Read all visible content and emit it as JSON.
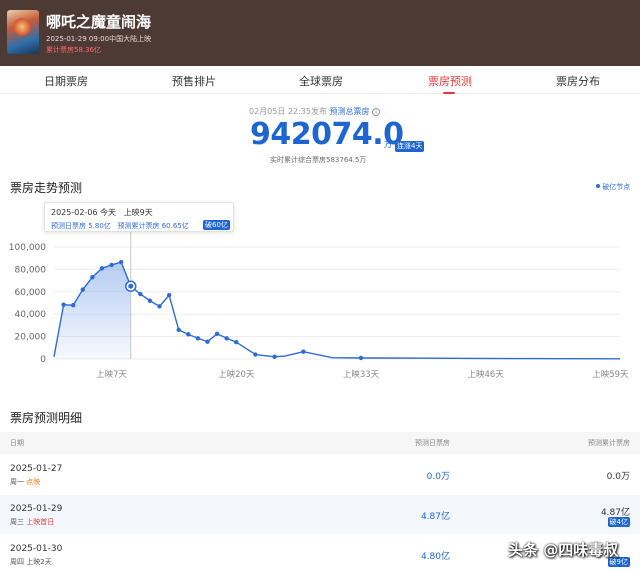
{
  "movie": {
    "title": "哪吒之魔童闹海",
    "release": "2025-01-29 09:00中国大陆上映",
    "cumulative": "累计票房58.36亿"
  },
  "tabs": [
    {
      "label": "日期票房"
    },
    {
      "label": "预售排片"
    },
    {
      "label": "全球票房"
    },
    {
      "label": "票房预测",
      "active": true
    },
    {
      "label": "票房分布"
    }
  ],
  "forecast": {
    "published": "02月05日 22:35发布",
    "label": "预测总票房",
    "value": "942074.0",
    "unit": "万",
    "badge": "连涨4天",
    "realtime": "实时累计综合票房583764.5万"
  },
  "trend": {
    "title": "票房走势预测",
    "legend": "破亿节点"
  },
  "tooltip": {
    "date": "2025-02-06",
    "weekday": "今天",
    "release_day": "上映9天",
    "daily": "预测日票房 5.80亿",
    "cumul": "预测累计票房 60.65亿",
    "badge": "破60亿"
  },
  "chart_data": {
    "type": "line",
    "y_ticks": [
      "100,000",
      "80,000",
      "60,000",
      "40,000",
      "20,000",
      "0"
    ],
    "ylim": [
      0,
      100000
    ],
    "x_ticks": [
      "上映7天",
      "上映20天",
      "上映33天",
      "上映46天",
      "上映59天"
    ],
    "x_tick_days": [
      7,
      20,
      33,
      46,
      59
    ],
    "xlim": [
      1,
      60
    ],
    "fill_until_day": 9,
    "highlight_day": 9,
    "series": [
      {
        "days": [
          1,
          2,
          3,
          4,
          5,
          6,
          7,
          8,
          9,
          10,
          11,
          12,
          13,
          14,
          15,
          16,
          17,
          18,
          19,
          20,
          22,
          24,
          25,
          27,
          30,
          33,
          35,
          40,
          45,
          50,
          55,
          60
        ],
        "values": [
          2000,
          48500,
          48000,
          62000,
          73000,
          81000,
          84000,
          86500,
          65000,
          58000,
          52000,
          47000,
          57000,
          26000,
          22000,
          18500,
          15500,
          22500,
          18500,
          15000,
          4000,
          2000,
          2500,
          6500,
          1200,
          900,
          900,
          700,
          500,
          400,
          300,
          200
        ],
        "markers": [
          2,
          3,
          4,
          5,
          6,
          7,
          8,
          9,
          10,
          11,
          12,
          13,
          14,
          15,
          16,
          17,
          18,
          19,
          20,
          22,
          24,
          27,
          33,
          46
        ]
      }
    ]
  },
  "detail": {
    "title": "票房预测明细",
    "col_date": "日期",
    "col_daily": "预测日票房",
    "col_cumul": "预测累计票房",
    "rows": [
      {
        "date": "2025-01-27",
        "weekday": "周一",
        "tag": "点映",
        "tag_color": "orange",
        "daily": "0.0万",
        "cumul": "0.0万",
        "badge": ""
      },
      {
        "date": "2025-01-29",
        "weekday": "周三",
        "tag": "上映首日",
        "tag_color": "red",
        "daily": "4.87亿",
        "cumul": "4.87亿",
        "badge": "破4亿"
      },
      {
        "date": "2025-01-30",
        "weekday": "周四",
        "tag": "上映2天",
        "tag_color": "none",
        "daily": "4.80亿",
        "cumul": "",
        "badge": "破9亿"
      }
    ]
  },
  "watermark": "头条 @四味毒叔"
}
